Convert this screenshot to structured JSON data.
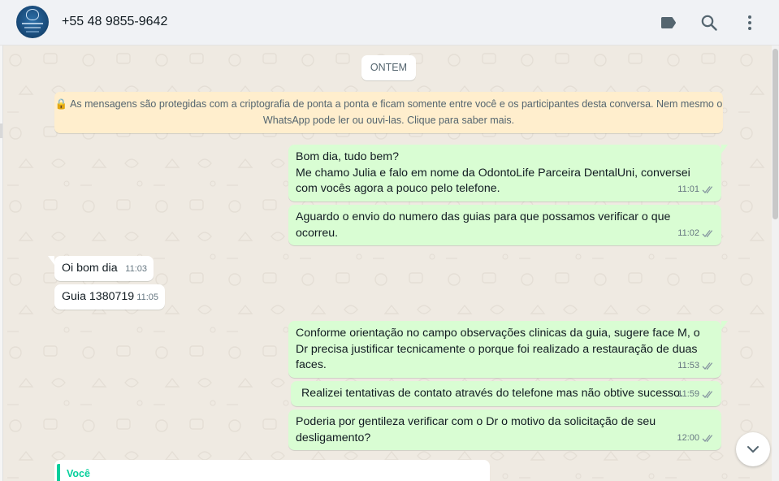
{
  "header": {
    "contact_name": "+55 48 9855-9642",
    "icons": [
      "label-icon",
      "search-icon",
      "menu-icon"
    ]
  },
  "chat": {
    "date_divider": "ONTEM",
    "encryption_notice": "🔒 As mensagens são protegidas com a criptografia de ponta a ponta e ficam somente entre você e os participantes desta conversa. Nem mesmo o WhatsApp pode ler ou ouvi-las. Clique para saber mais.",
    "messages": [
      {
        "direction": "out",
        "text": "Bom dia, tudo bem?\nMe chamo Julia e falo em nome da OdontoLife Parceira DentalUni, conversei com vocês agora a pouco pelo telefone.",
        "time": "11:01",
        "status": "read"
      },
      {
        "direction": "out",
        "text": "Aguardo o envio do numero das guias para que possamos verificar o que ocorreu.",
        "time": "11:02",
        "status": "read"
      },
      {
        "direction": "in",
        "text": "Oi bom dia",
        "time": "11:03"
      },
      {
        "direction": "in",
        "text": "Guia 1380719",
        "time": "11:05"
      },
      {
        "direction": "out",
        "text": "Conforme orientação no campo observações clinicas da guia, sugere face M, o Dr precisa justificar tecnicamente o porque foi realizado a restauração de duas faces.",
        "time": "11:53",
        "status": "read"
      },
      {
        "direction": "out",
        "text": " Realizei tentativas de contato através do telefone mas não obtive sucesso.",
        "time": "11:59",
        "status": "read"
      },
      {
        "direction": "out",
        "text": "Poderia por gentileza verificar com o Dr o motivo da solicitação de seu desligamento?",
        "time": "12:00",
        "status": "read"
      }
    ],
    "reply_preview": {
      "sender": "Você"
    }
  },
  "colors": {
    "chat_background": "#efeae2",
    "outgoing_bubble": "#d9fdd3",
    "incoming_bubble": "#ffffff",
    "notice_background": "#ffeecd",
    "read_ticks": "#8696a0",
    "reply_accent": "#06cf9c"
  }
}
